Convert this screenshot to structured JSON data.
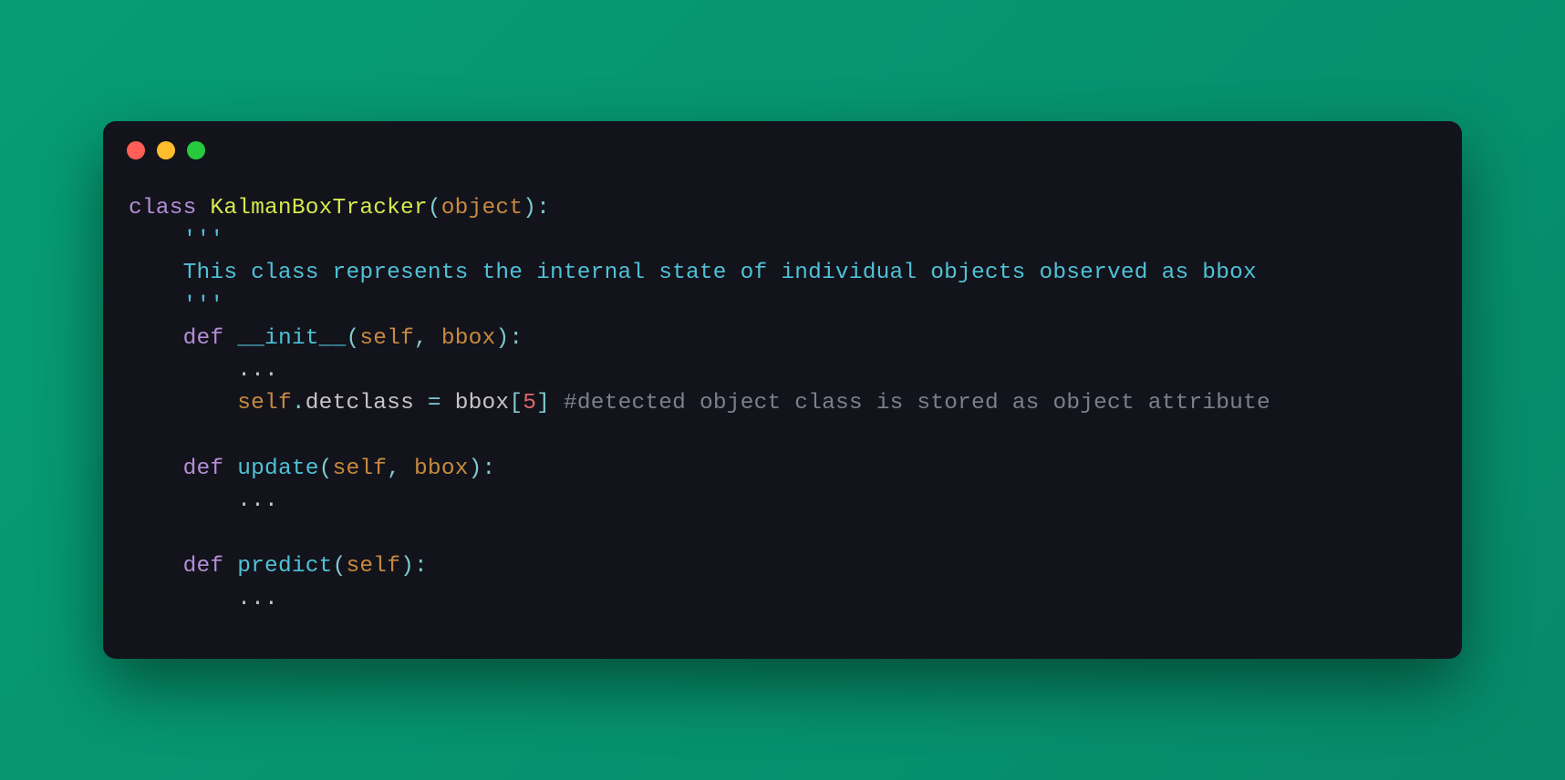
{
  "code": {
    "keyword_class": "class",
    "class_name": "KalmanBoxTracker",
    "paren_open": "(",
    "base_class": "object",
    "paren_close_colon": "):",
    "docstring_open": "    '''",
    "docstring_body": "    This class represents the internal state of individual objects observed as bbox",
    "docstring_close": "    '''",
    "def1_indent": "    ",
    "keyword_def": "def",
    "space": " ",
    "init_name": "__init__",
    "init_params_open": "(",
    "self_param": "self",
    "comma_space": ", ",
    "bbox_param": "bbox",
    "close_colon": "):",
    "ellipsis_indent": "        ",
    "ellipsis": "...",
    "stmt_indent": "        ",
    "self_attr": "self",
    "dot": ".",
    "detclass_attr": "detclass",
    "assign": " = ",
    "bbox_ref": "bbox",
    "bracket_open": "[",
    "index_val": "5",
    "bracket_close": "]",
    "comment_text": " #detected object class is stored as object attribute",
    "update_name": "update",
    "predict_name": "predict",
    "predict_params": "self"
  }
}
